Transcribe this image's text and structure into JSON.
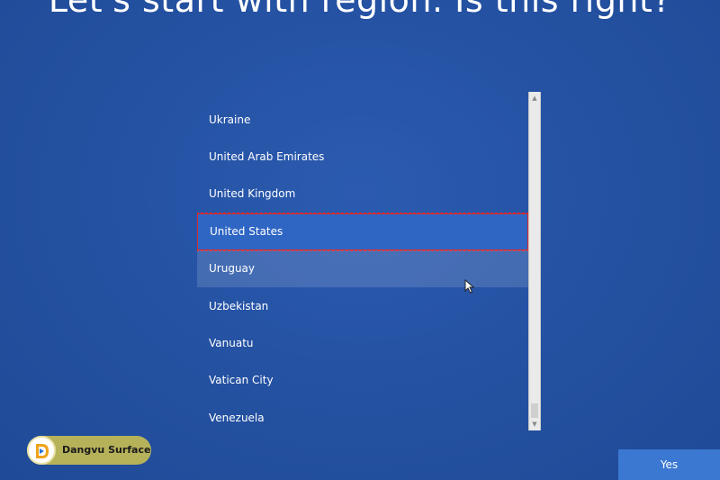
{
  "page": {
    "title": "Let's start with region. Is this right?"
  },
  "region_list": {
    "items": [
      {
        "label": "Ukraine",
        "state": "normal"
      },
      {
        "label": "United Arab Emirates",
        "state": "normal"
      },
      {
        "label": "United Kingdom",
        "state": "normal"
      },
      {
        "label": "United States",
        "state": "selected"
      },
      {
        "label": "Uruguay",
        "state": "hover"
      },
      {
        "label": "Uzbekistan",
        "state": "normal"
      },
      {
        "label": "Vanuatu",
        "state": "normal"
      },
      {
        "label": "Vatican City",
        "state": "normal"
      },
      {
        "label": "Venezuela",
        "state": "normal"
      }
    ]
  },
  "buttons": {
    "yes_label": "Yes"
  },
  "watermark": {
    "text": "Dangvu Surface"
  },
  "icons": {
    "scroll_up": "chevron-up-icon",
    "scroll_down": "chevron-down-icon",
    "cursor": "mouse-pointer-icon",
    "logo": "dangvu-logo-icon"
  },
  "colors": {
    "background": "#2552a3",
    "selected_item": "#2f66c4",
    "selection_outline": "#e02a2a",
    "button": "#3a78d2",
    "watermark_bg": "#b6b25a"
  }
}
